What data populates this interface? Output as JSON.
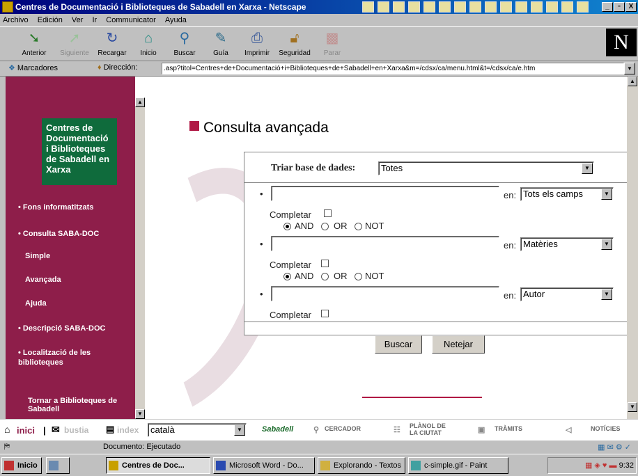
{
  "window": {
    "title": "Centres de Documentació i Biblioteques de Sabadell en Xarxa - Netscape",
    "min": "_",
    "restore": "▫",
    "close": "X"
  },
  "menu": [
    "Archivo",
    "Edición",
    "Ver",
    "Ir",
    "Communicator",
    "Ayuda"
  ],
  "toolbar": [
    {
      "label": "Anterior",
      "icon": "back-arrow-icon",
      "enabled": true
    },
    {
      "label": "Siguiente",
      "icon": "forward-arrow-icon",
      "enabled": false
    },
    {
      "label": "Recargar",
      "icon": "reload-icon",
      "enabled": true
    },
    {
      "label": "Inicio",
      "icon": "home-icon",
      "enabled": true
    },
    {
      "label": "Buscar",
      "icon": "search-icon",
      "enabled": true
    },
    {
      "label": "Guía",
      "icon": "guide-icon",
      "enabled": true
    },
    {
      "label": "Imprimir",
      "icon": "print-icon",
      "enabled": true
    },
    {
      "label": "Seguridad",
      "icon": "security-lock-icon",
      "enabled": true
    },
    {
      "label": "Parar",
      "icon": "stop-icon",
      "enabled": false
    }
  ],
  "location": {
    "bookmarks_label": "Marcadores",
    "address_label": "Dirección:",
    "url": ".asp?titol=Centres+de+Documentació+i+Biblioteques+de+Sabadell+en+Xarxa&m=/cdsx/ca/menu.html&t=/cdsx/ca/e.htm"
  },
  "sidebar": {
    "title": "Centres de Documentació i Biblioteques de Sabadell en Xarxa",
    "links": [
      {
        "label": "• Fons informatitzats",
        "sub": false
      },
      {
        "label": "• Consulta SABA-DOC",
        "sub": false
      },
      {
        "label": "Simple",
        "sub": true
      },
      {
        "label": "Avançada",
        "sub": true
      },
      {
        "label": "Ajuda",
        "sub": true
      },
      {
        "label": "• Descripció SABA-DOC",
        "sub": false
      },
      {
        "label": "• Localització de les biblioteques",
        "sub": false
      },
      {
        "label": "Tornar a Biblioteques de Sabadell",
        "sub": false
      }
    ]
  },
  "main": {
    "title": "Consulta avançada",
    "db_label": "Triar base de dades:",
    "db_value": "Totes",
    "rows": [
      {
        "value": "",
        "en_label": "en:",
        "field": "Tots els camps",
        "complete_label": "Completar"
      },
      {
        "value": "",
        "en_label": "en:",
        "field": "Matèries",
        "complete_label": "Completar"
      },
      {
        "value": "",
        "en_label": "en:",
        "field": "Autor",
        "complete_label": "Completar"
      }
    ],
    "operators": [
      "AND",
      "OR",
      "NOT"
    ],
    "search_button": "Buscar",
    "clear_button": "Netejar"
  },
  "bottom": {
    "inici": "inici",
    "bustia": "bustia",
    "index": "index",
    "language": "català",
    "sabadell": "Sabadell",
    "cercador": "CERCADOR",
    "planol": "PLÀNOL DE LA CIUTAT",
    "tramits": "TRÀMITS",
    "noticies": "NOTÍCIES"
  },
  "status": "Documento: Ejecutado",
  "taskbar": {
    "start": "Inicio",
    "items": [
      "Centres de Doc...",
      "Microsoft Word - Do...",
      "Explorando - Textos",
      "c-simple.gif - Paint"
    ],
    "clock": "9:32"
  },
  "colors": {
    "sidebar": "#8e1e4a",
    "sidebox": "#0f6b3c",
    "accent": "#b01844"
  }
}
